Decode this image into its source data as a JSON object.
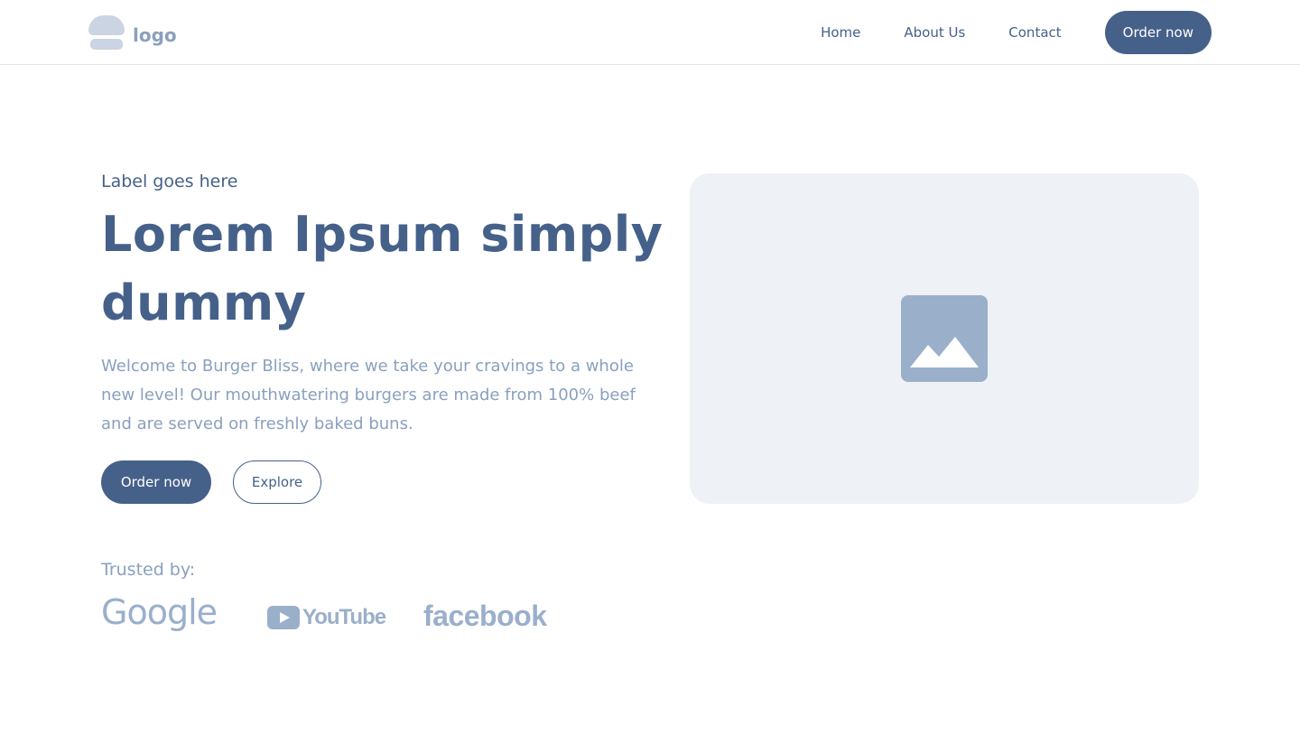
{
  "nav": {
    "logo_text": "logo",
    "links": [
      "Home",
      "About Us",
      "Contact"
    ],
    "cta_label": "Order now"
  },
  "hero": {
    "label": "Label goes here",
    "title": "Lorem Ipsum simply dummy",
    "description": "Welcome to Burger Bliss, where we take your cravings to a whole new level! Our mouthwatering burgers are made from 100% beef and are served on freshly baked buns.",
    "primary_button": "Order now",
    "secondary_button": "Explore",
    "image_icon": "image-placeholder-icon"
  },
  "trusted": {
    "label": "Trusted by:",
    "brands": [
      "Google",
      "YouTube",
      "facebook"
    ],
    "youtube_wordmark": "YouTube"
  },
  "colors": {
    "primary": "#45618a",
    "muted": "#8aa0bf",
    "logo_muted": "#9aafca",
    "placeholder_bg": "#eef1f6"
  }
}
